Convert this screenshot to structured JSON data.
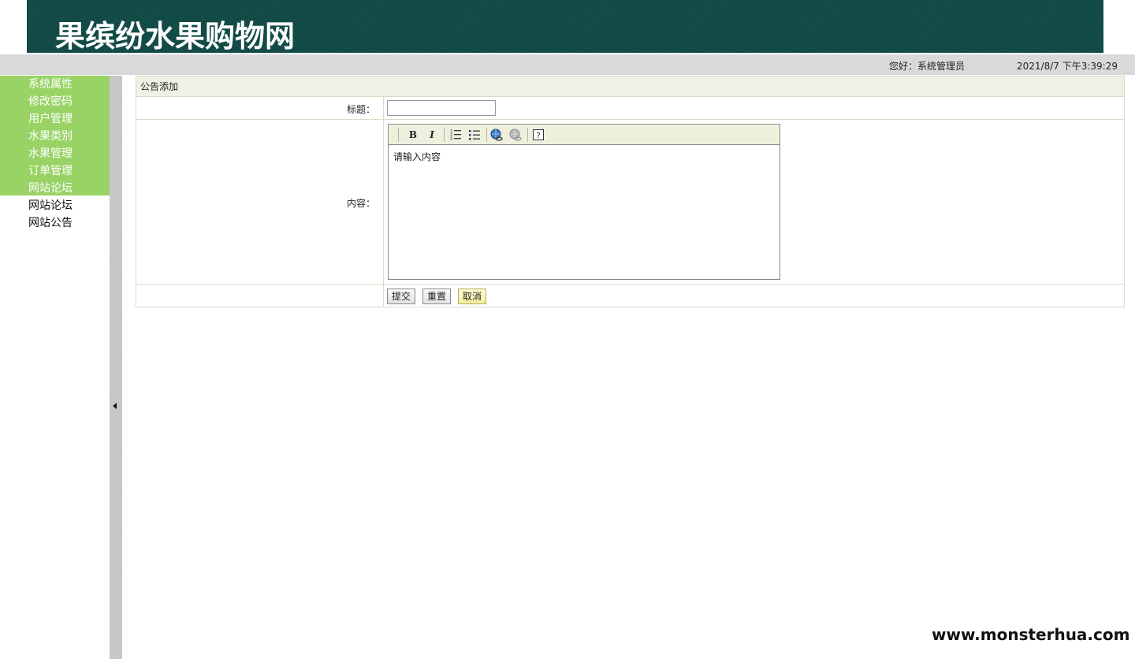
{
  "header": {
    "site_title": "果缤纷水果购物网"
  },
  "status": {
    "greeting": "您好：系统管理员",
    "datetime": "2021/8/7 下午3:39:29"
  },
  "sidebar": {
    "items": [
      {
        "label": "系统属性"
      },
      {
        "label": "修改密码"
      },
      {
        "label": "用户管理"
      },
      {
        "label": "水果类别"
      },
      {
        "label": "水果管理"
      },
      {
        "label": "订单管理"
      },
      {
        "label": "网站论坛"
      }
    ],
    "subitems": [
      {
        "label": "网站论坛"
      },
      {
        "label": "网站公告"
      }
    ]
  },
  "form": {
    "panel_title": "公告添加",
    "title_label": "标题：",
    "title_value": "",
    "content_label": "内容：",
    "content_placeholder": "请输入内容",
    "toolbar": {
      "bold": "B",
      "italic": "I",
      "ordered_list_icon": "ordered-list-icon",
      "unordered_list_icon": "unordered-list-icon",
      "link_icon": "link-icon",
      "unlink_icon": "unlink-icon",
      "help": "?"
    },
    "buttons": {
      "submit": "提交",
      "reset": "重置",
      "cancel": "取消"
    }
  },
  "watermark": "www.monsterhua.com",
  "colors": {
    "header_bg": "#0f4a45",
    "menu_active_bg": "#99d366",
    "statusbar_bg": "#d9d9d9",
    "panel_title_bg": "#f0f0e4",
    "cancel_button_bg": "#f2ee9c"
  }
}
